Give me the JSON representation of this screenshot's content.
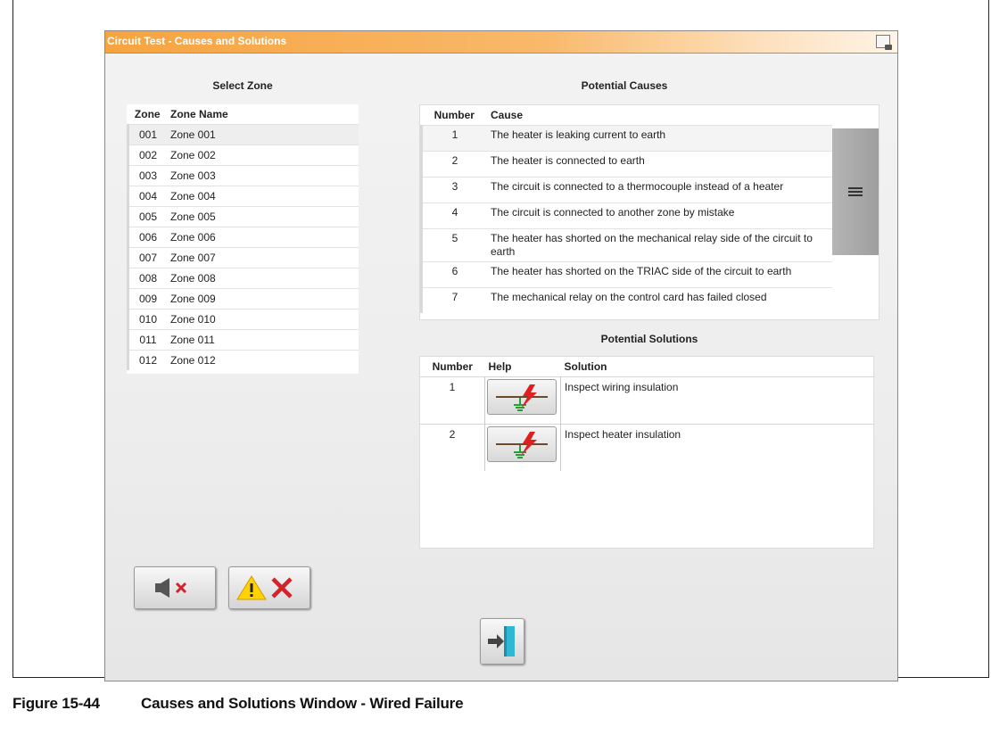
{
  "window": {
    "title": "Circuit Test - Causes and Solutions",
    "title_icon": "screenshot-icon"
  },
  "zones": {
    "heading": "Select Zone",
    "columns": [
      "Zone",
      "Zone Name"
    ],
    "rows": [
      {
        "zone": "001",
        "name": "Zone 001"
      },
      {
        "zone": "002",
        "name": "Zone 002"
      },
      {
        "zone": "003",
        "name": "Zone 003"
      },
      {
        "zone": "004",
        "name": "Zone 004"
      },
      {
        "zone": "005",
        "name": "Zone 005"
      },
      {
        "zone": "006",
        "name": "Zone 006"
      },
      {
        "zone": "007",
        "name": "Zone 007"
      },
      {
        "zone": "008",
        "name": "Zone 008"
      },
      {
        "zone": "009",
        "name": "Zone 009"
      },
      {
        "zone": "010",
        "name": "Zone 010"
      },
      {
        "zone": "011",
        "name": "Zone 011"
      },
      {
        "zone": "012",
        "name": "Zone 012"
      }
    ],
    "selected_index": 0
  },
  "causes": {
    "heading": "Potential Causes",
    "columns": [
      "Number",
      "Cause"
    ],
    "rows": [
      {
        "number": "1",
        "cause": "The heater is leaking current to earth"
      },
      {
        "number": "2",
        "cause": "The heater is connected to earth"
      },
      {
        "number": "3",
        "cause": "The circuit is connected to a thermocouple instead of a heater"
      },
      {
        "number": "4",
        "cause": "The circuit is connected to another zone by mistake"
      },
      {
        "number": "5",
        "cause": "The heater has shorted on the mechanical relay side of the circuit to earth"
      },
      {
        "number": "6",
        "cause": "The heater has shorted on the TRIAC side of the circuit to earth"
      },
      {
        "number": "7",
        "cause": "The mechanical relay on the control card has failed closed"
      }
    ],
    "scroll_icon": "menu-lines-icon"
  },
  "solutions": {
    "heading": "Potential Solutions",
    "columns": [
      "Number",
      "Help",
      "Solution"
    ],
    "rows": [
      {
        "number": "1",
        "help_icon": "ground-fault-icon",
        "solution": "Inspect wiring insulation"
      },
      {
        "number": "2",
        "help_icon": "ground-fault-icon",
        "solution": "Inspect heater insulation"
      }
    ]
  },
  "buttons": {
    "mute_icon": "speaker-mute-icon",
    "clear_alarm_icon": "warning-clear-icon",
    "exit_icon": "exit-door-icon"
  },
  "caption": {
    "number": "Figure 15-44",
    "text": "Causes and Solutions Window - Wired Failure"
  },
  "colors": {
    "titlebar": "#f6a43f",
    "red_x": "#d2232a",
    "warning_yellow": "#ffd200",
    "exit_teal": "#2fb8d4"
  }
}
